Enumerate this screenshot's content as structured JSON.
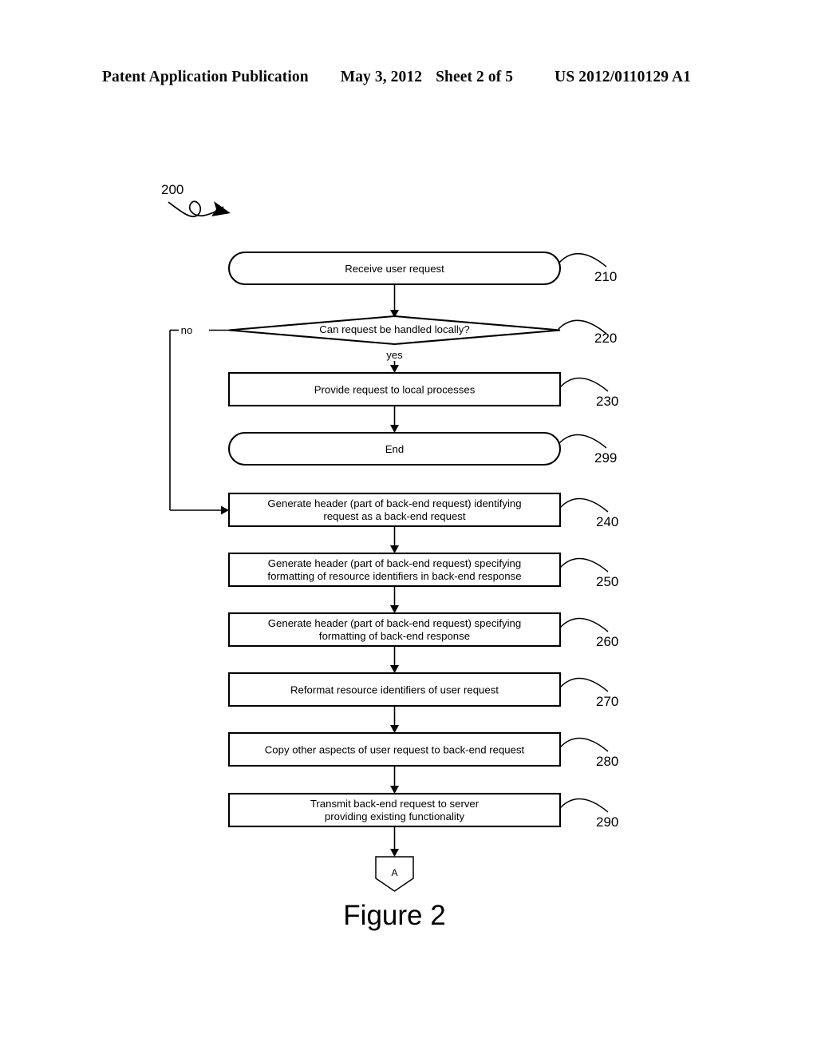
{
  "header": {
    "publication": "Patent Application Publication",
    "date": "May 3, 2012",
    "sheet": "Sheet 2 of 5",
    "number": "US 2012/0110129 A1"
  },
  "figure": {
    "caption": "Figure 2",
    "diagram_ref": "200"
  },
  "nodes": {
    "start": {
      "ref": "210",
      "text": "Receive user request",
      "shape": "terminal"
    },
    "decision": {
      "ref": "220",
      "text": "Can request be handled locally?",
      "shape": "diamond"
    },
    "local": {
      "ref": "230",
      "text": "Provide request to local processes",
      "shape": "process"
    },
    "end": {
      "ref": "299",
      "text": "End",
      "shape": "terminal"
    },
    "header_identify": {
      "ref": "240",
      "line1": "Generate header (part of back-end request) identifying",
      "line2": "request as a back-end request",
      "shape": "process"
    },
    "header_resource_fmt": {
      "ref": "250",
      "line1": "Generate header (part of back-end request) specifying",
      "line2": "formatting of resource identifiers in back-end response",
      "shape": "process"
    },
    "header_response_fmt": {
      "ref": "260",
      "line1": "Generate header (part of back-end request) specifying",
      "line2": "formatting of back-end response",
      "shape": "process"
    },
    "reformat": {
      "ref": "270",
      "text": "Reformat resource identifiers of user request",
      "shape": "process"
    },
    "copy_aspects": {
      "ref": "280",
      "text": "Copy other aspects of user request to back-end request",
      "shape": "process"
    },
    "transmit": {
      "ref": "290",
      "line1": "Transmit back-end request to server",
      "line2": "providing existing functionality",
      "shape": "process"
    },
    "connector_a": {
      "text": "A",
      "shape": "offpage-connector"
    }
  },
  "edges": {
    "no_label": "no",
    "yes_label": "yes"
  },
  "colors": {
    "ink": "#000000",
    "paper": "#ffffff"
  }
}
